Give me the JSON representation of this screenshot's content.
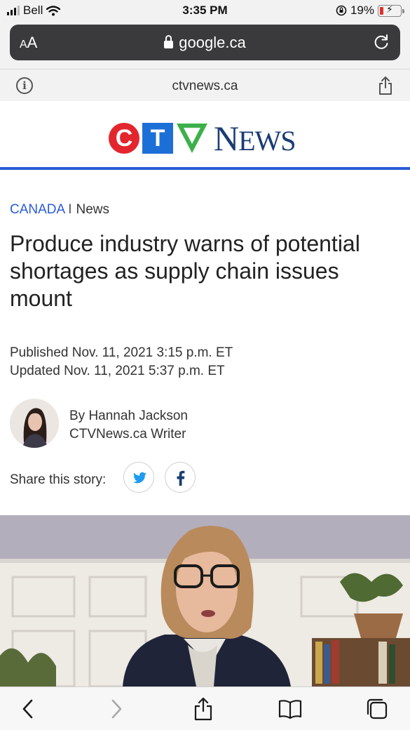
{
  "status_bar": {
    "carrier": "Bell",
    "time": "3:35 PM",
    "battery_percent": "19%",
    "battery_level": 0.19
  },
  "browser": {
    "aa_label_small": "A",
    "aa_label_large": "A",
    "url": "google.ca",
    "page_domain": "ctvnews.ca"
  },
  "logo": {
    "c": "C",
    "t": "T",
    "news_initial": "N",
    "news_rest": "EWS"
  },
  "article": {
    "category": "CANADA",
    "separator": "I",
    "section": "News",
    "headline": "Produce industry warns of potential shortages as supply chain issues mount",
    "published": "Published Nov. 11, 2021 3:15 p.m. ET",
    "updated": "Updated Nov. 11, 2021 5:37 p.m. ET",
    "author": "By Hannah Jackson",
    "author_role": "CTVNews.ca Writer",
    "share_label": "Share this story:"
  },
  "colors": {
    "accent_blue": "#2a5bd7",
    "ctv_red": "#e3262d",
    "ctv_blue": "#1d6fd8",
    "ctv_green": "#3cb04a",
    "news_navy": "#1a3c74",
    "twitter_blue": "#1d9bf0",
    "facebook_navy": "#1a3c74"
  },
  "icons": {
    "info": "info-icon",
    "reload": "reload-icon",
    "share": "share-icon",
    "back": "back-icon",
    "forward": "forward-icon",
    "bookmarks": "book-icon",
    "tabs": "tabs-icon"
  }
}
